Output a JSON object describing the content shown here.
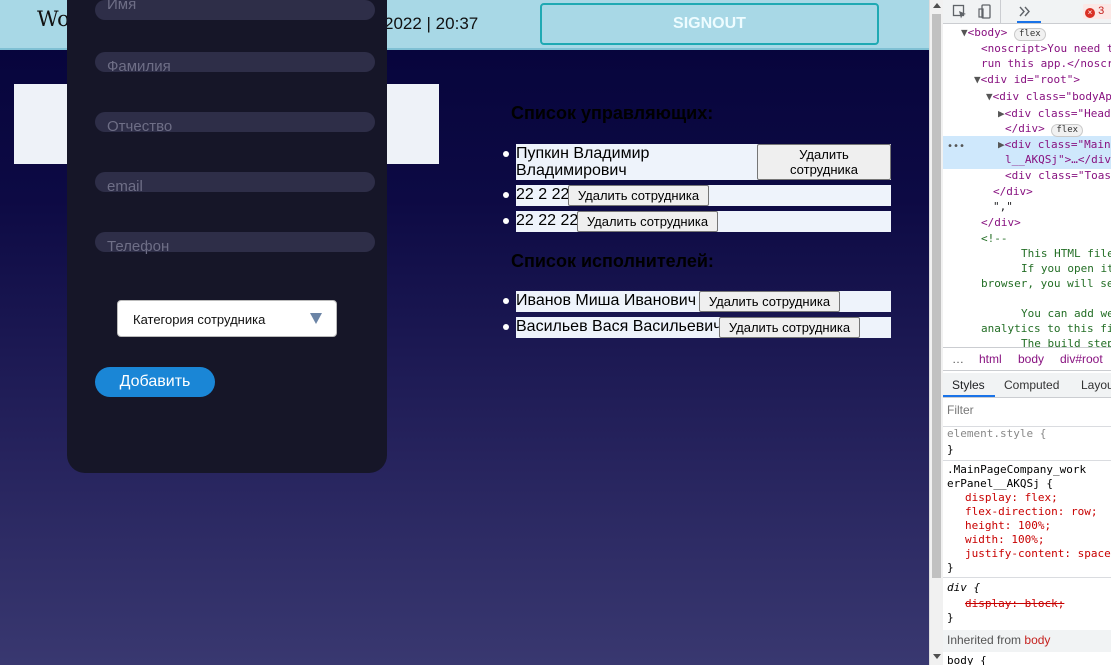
{
  "header": {
    "logo": "Wo",
    "datetime": "2022 | 20:37",
    "signout_label": "SIGNOUT"
  },
  "form": {
    "fields": [
      {
        "placeholder": "Имя"
      },
      {
        "placeholder": "Фамилия"
      },
      {
        "placeholder": "Отчество"
      },
      {
        "placeholder": "email"
      },
      {
        "placeholder": "Телефон"
      }
    ],
    "select_value": "Категория сотрудника",
    "add_label": "Добавить"
  },
  "managers": {
    "title": "Список управляющих:",
    "items": [
      {
        "name": "Пупкин Владимир Владимирович",
        "delete_label": "Удалить сотрудника"
      },
      {
        "name": "22 2 22",
        "delete_label": "Удалить сотрудника"
      },
      {
        "name": "22 22 22",
        "delete_label": "Удалить сотрудника"
      }
    ]
  },
  "executors": {
    "title": "Список исполнителей:",
    "items": [
      {
        "name": "Иванов Миша Иванович",
        "delete_label": "Удалить сотрудника"
      },
      {
        "name": "Васильев Вася Васильевич",
        "delete_label": "Удалить сотрудника"
      }
    ]
  },
  "devtools": {
    "error_count": "3",
    "dom": [
      {
        "text": "<body>",
        "pill": "flex"
      },
      {
        "text": "<noscript>You need t"
      },
      {
        "text": "run this app.</noscr"
      },
      {
        "text": "<div id=\"root\">"
      },
      {
        "text": "<div class=\"bodyAp"
      },
      {
        "text": "<div class=\"Head"
      },
      {
        "text": "</div>",
        "pill": "flex"
      },
      {
        "text": "<div class=\"Main"
      },
      {
        "text": "l__AKQSj\">…</div"
      },
      {
        "text": "<div class=\"Toas"
      },
      {
        "text": "</div>"
      },
      {
        "text": "\",\""
      },
      {
        "text": "</div>"
      },
      {
        "text": "<!--"
      },
      {
        "text": "This HTML file"
      },
      {
        "text": "If you open it"
      },
      {
        "text": "browser, you will se"
      },
      {
        "text": "You can add we"
      },
      {
        "text": "analytics to this fi"
      },
      {
        "text": "The build step"
      }
    ],
    "breadcrumbs": [
      "…",
      "html",
      "body",
      "div#root"
    ],
    "tabs": [
      "Styles",
      "Computed",
      "Layou"
    ],
    "filter_placeholder": "Filter",
    "styles": [
      "element.style {",
      "}",
      ".MainPageCompany_work",
      "erPanel__AKQSj {",
      "display: flex;",
      "flex-direction: row;",
      "height: 100%;",
      "width: 100%;",
      "justify-content: space",
      "}",
      "div {",
      "display: block;",
      "}"
    ],
    "inherited_label": "Inherited from",
    "inherited_from": "body",
    "last_rule": "body {"
  }
}
